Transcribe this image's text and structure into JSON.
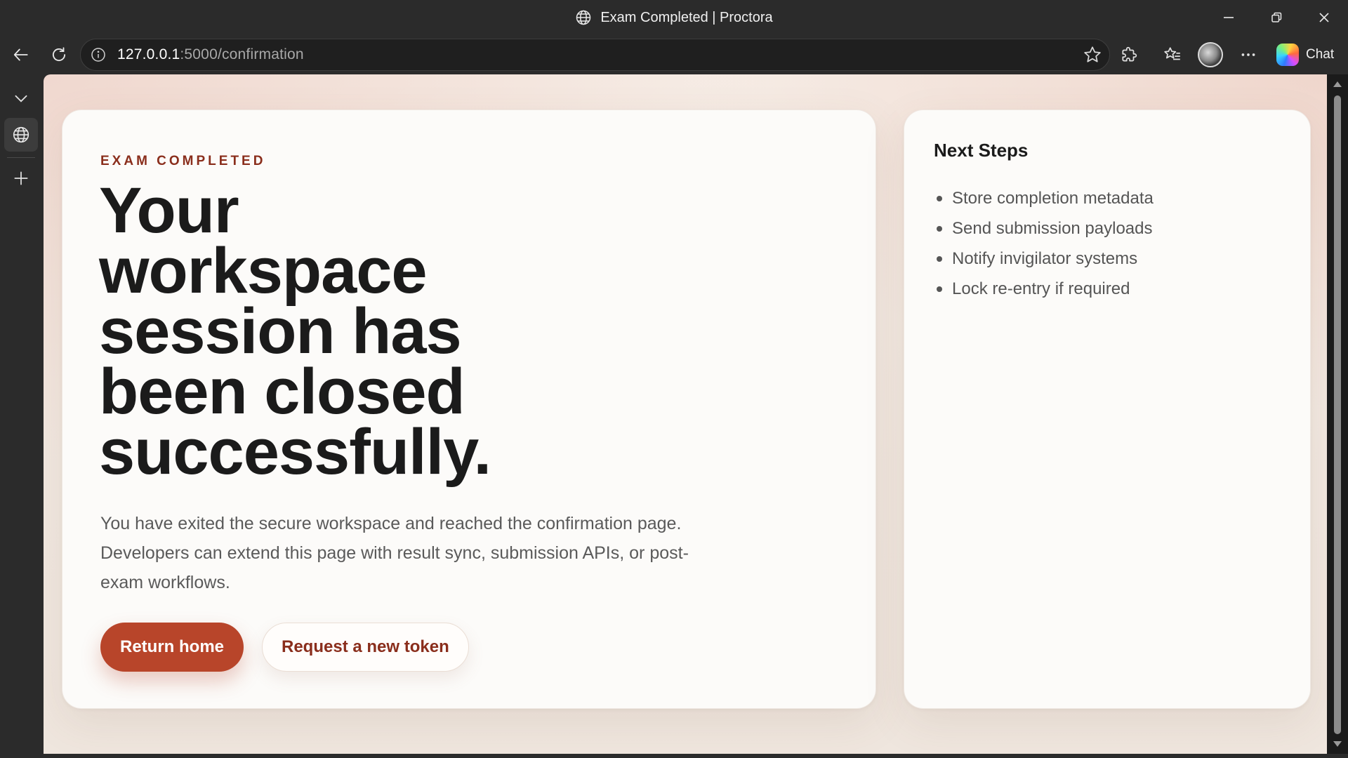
{
  "window": {
    "title": "Exam Completed | Proctora",
    "controls": [
      "minimize",
      "restore",
      "close"
    ]
  },
  "toolbar": {
    "url_host": "127.0.0.1",
    "url_rest": ":5000/confirmation",
    "chat_label": "Chat"
  },
  "page": {
    "eyebrow": "EXAM COMPLETED",
    "headline": "Your workspace session has been closed successfully.",
    "lead": "You have exited the secure workspace and reached the confirmation page. Developers can extend this page with result sync, submission APIs, or post-exam workflows.",
    "primary_button": "Return home",
    "secondary_button": "Request a new token"
  },
  "next_steps": {
    "title": "Next Steps",
    "items": [
      "Store completion metadata",
      "Send submission payloads",
      "Notify invigilator systems",
      "Lock re-entry if required"
    ]
  },
  "colors": {
    "accent": "#b8452a",
    "eyebrow": "#8a2e1c",
    "browser_chrome": "#2b2b2b"
  }
}
